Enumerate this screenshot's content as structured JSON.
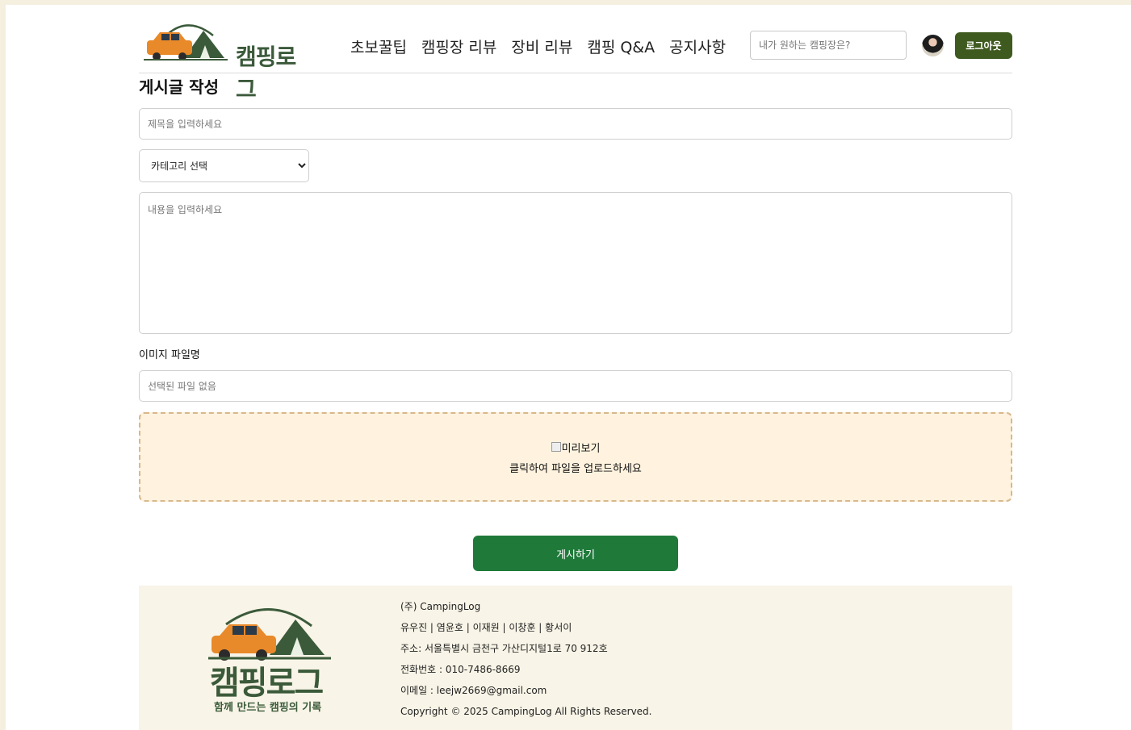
{
  "brand": {
    "name": "캠핑로그",
    "slogan": "함께 만드는 캠핑의 기록"
  },
  "nav": [
    "초보꿀팁",
    "캠핑장 리뷰",
    "장비 리뷰",
    "캠핑 Q&A",
    "공지사항"
  ],
  "search": {
    "placeholder": "내가 원하는 캠핑장은?"
  },
  "header": {
    "logout_label": "로그아웃"
  },
  "form": {
    "heading": "게시글 작성",
    "title_placeholder": "제목을 입력하세요",
    "category_selected": "카테고리 선택",
    "content_placeholder": "내용을 입력하세요",
    "image_label": "이미지 파일명",
    "file_placeholder": "선택된 파일 없음",
    "preview_alt": "미리보기",
    "upload_text": "클릭하여 파일을 업로드하세요",
    "submit_label": "게시하기"
  },
  "footer": {
    "lines": [
      "(주) CampingLog",
      "유우진 | 염윤호 | 이재원 | 이창훈 | 황서이",
      "주소: 서울특별시 금천구 가산디지털1로 70 912호",
      "전화번호 : 010-7486-8669",
      "이메일 : leejw2669@gmail.com",
      "Copyright © 2025 CampingLog All Rights Reserved."
    ]
  },
  "colors": {
    "brand_green": "#3b5a3a",
    "logout_bg": "#3f5a1f",
    "submit_bg": "#1f7a3a",
    "dropzone_bg": "#fff3df",
    "car_orange": "#e8892a"
  }
}
